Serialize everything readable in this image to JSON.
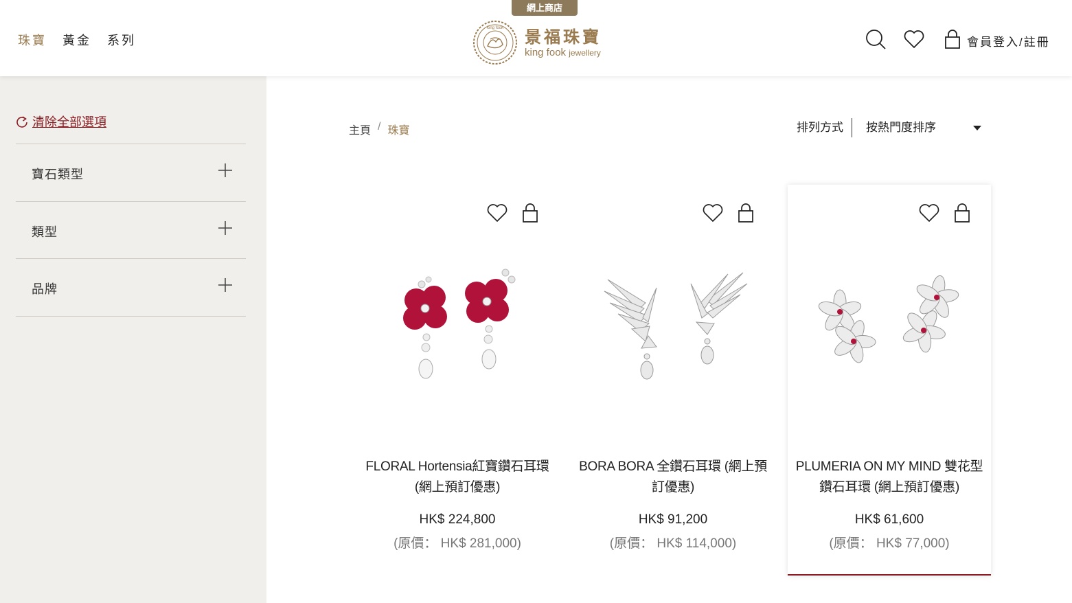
{
  "header": {
    "nav": [
      {
        "label": "珠寶",
        "active": true
      },
      {
        "label": "黃金",
        "active": false
      },
      {
        "label": "系列",
        "active": false
      }
    ],
    "badge": "網上商店",
    "logo": {
      "cn": "景福珠寶",
      "en_main": "king fook",
      "en_small": "jewellery",
      "seal_text": "king fook"
    },
    "icons": [
      "search-icon",
      "heart-icon",
      "shopping-bag-icon"
    ],
    "member": "會員登入/註冊"
  },
  "sidebar": {
    "clear_label": "清除全部選項",
    "filters": [
      {
        "label": "寶石類型"
      },
      {
        "label": "類型"
      },
      {
        "label": "品牌"
      }
    ]
  },
  "breadcrumb": {
    "home": "主頁",
    "sep": "/",
    "current": "珠寶"
  },
  "sort": {
    "label": "排列方式",
    "value": "按熱門度排序"
  },
  "products": [
    {
      "name": "FLORAL Hortensia紅寶鑽石耳環 (網上預訂優惠)",
      "price": "HK$ 224,800",
      "original": "(原價： HK$ 281,000)"
    },
    {
      "name": "BORA BORA 全鑽石耳環 (網上預訂優惠)",
      "price": "HK$ 91,200",
      "original": "(原價： HK$ 114,000)"
    },
    {
      "name": "PLUMERIA ON MY MIND 雙花型鑽石耳環 (網上預訂優惠)",
      "price": "HK$ 61,600",
      "original": "(原價： HK$ 77,000)"
    }
  ],
  "colors": {
    "accent_gold": "#9a7b4f",
    "accent_red": "#8a1c22",
    "sidebar_bg": "#f1efeb",
    "ruby": "#b0123a"
  }
}
